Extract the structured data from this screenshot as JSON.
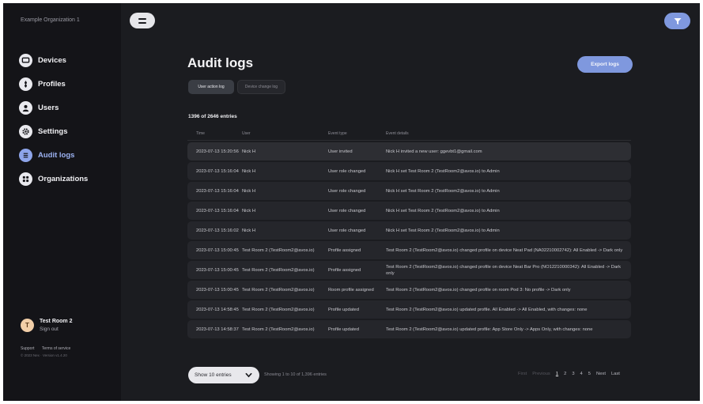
{
  "sidebar": {
    "org_name": "Example Organization 1",
    "items": [
      {
        "label": "Devices",
        "icon": "monitor-icon"
      },
      {
        "label": "Profiles",
        "icon": "sliders-icon"
      },
      {
        "label": "Users",
        "icon": "user-icon"
      },
      {
        "label": "Settings",
        "icon": "gear-icon"
      },
      {
        "label": "Audit logs",
        "icon": "list-icon",
        "active": true
      },
      {
        "label": "Organizations",
        "icon": "grid-icon"
      }
    ],
    "user": {
      "avatar_initial": "T",
      "name": "Test Room 2",
      "sign_out": "Sign out"
    },
    "footer": {
      "support": "Support",
      "terms": "Terms of service",
      "meta": "© 2023 Nex · Version v1.4.20"
    }
  },
  "colors": {
    "accent": "#7f98de",
    "background": "#1b1c20",
    "sidebar": "#141418"
  },
  "header": {
    "title": "Audit logs",
    "export_label": "Export logs"
  },
  "tabs": {
    "user_action": "User action log",
    "device_change": "Device change log"
  },
  "table": {
    "entries_count": "1396 of 2646 entries",
    "columns": [
      "Time",
      "User",
      "Event type",
      "Event details"
    ],
    "rows": [
      {
        "time": "2023-07-13 15:20:56",
        "user": "Nick H",
        "event": "User invited",
        "details": "Nick H invited a new user: ggevbt1@gmail.com"
      },
      {
        "time": "2023-07-13 15:16:04",
        "user": "Nick H",
        "event": "User role changed",
        "details": "Nick H set Test Room 2 (TestRoom2@avos.io) to Admin"
      },
      {
        "time": "2023-07-13 15:16:04",
        "user": "Nick H",
        "event": "User role changed",
        "details": "Nick H set Test Room 2 (TestRoom2@avos.io) to Admin"
      },
      {
        "time": "2023-07-13 15:16:04",
        "user": "Nick H",
        "event": "User role changed",
        "details": "Nick H set Test Room 2 (TestRoom2@avos.io) to Admin"
      },
      {
        "time": "2023-07-13 15:16:02",
        "user": "Nick H",
        "event": "User role changed",
        "details": "Nick H set Test Room 2 (TestRoom2@avos.io) to Admin"
      },
      {
        "time": "2023-07-13 15:00:45",
        "user": "Test Room 2 (TestRoom2@avos.io)",
        "event": "Profile assigned",
        "details": "Test Room 2 (TestRoom2@avos.io) changed profile on device Neat Pad (NA02210002742): All Enabled -> Dark only"
      },
      {
        "time": "2023-07-13 15:00:45",
        "user": "Test Room 2 (TestRoom2@avos.io)",
        "event": "Profile assigned",
        "details": "Test Room 2 (TestRoom2@avos.io) changed profile on device Neat Bar Pro (NO12210000342): All Enabled -> Dark only"
      },
      {
        "time": "2023-07-13 15:00:45",
        "user": "Test Room 2 (TestRoom2@avos.io)",
        "event": "Room profile assigned",
        "details": "Test Room 2 (TestRoom2@avos.io) changed profile on room Pod 3: No profile -> Dark only"
      },
      {
        "time": "2023-07-13 14:58:45",
        "user": "Test Room 2 (TestRoom2@avos.io)",
        "event": "Profile updated",
        "details": "Test Room 2 (TestRoom2@avos.io) updated profile. All Enabled -> All Enabled, with changes: none"
      },
      {
        "time": "2023-07-13 14:58:37",
        "user": "Test Room 2 (TestRoom2@avos.io)",
        "event": "Profile updated",
        "details": "Test Room 2 (TestRoom2@avos.io) updated profile: App Store Only -> Apps Only, with changes: none"
      }
    ]
  },
  "footer_bar": {
    "show_select": "Show 10 entries",
    "showing": "Showing 1 to 10 of 1,396 entries",
    "pagination": {
      "first": "First",
      "previous": "Previous",
      "pages": [
        "1",
        "2",
        "3",
        "4",
        "5"
      ],
      "current": "1",
      "next": "Next",
      "last": "Last"
    }
  }
}
